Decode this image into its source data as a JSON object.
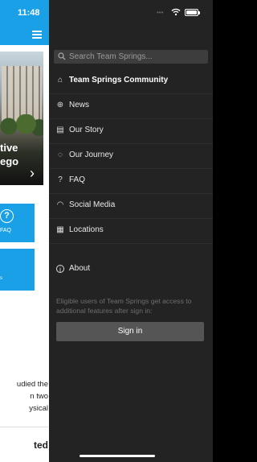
{
  "status_bar": {
    "time": "11:48"
  },
  "app": {
    "hero_caption_lines": [
      "tive",
      "ego"
    ],
    "tiles": [
      {
        "icon": "question-circle-icon",
        "label": "FAQ"
      },
      {
        "label": "s"
      }
    ],
    "body_text_lines": [
      "udied the",
      "n two",
      "ysical"
    ],
    "bottom_text": "ted"
  },
  "drawer": {
    "search": {
      "placeholder": "Search Team Springs..."
    },
    "nav_items": [
      {
        "label": "Team Springs Community",
        "icon": "home-icon",
        "active": true
      },
      {
        "label": "News",
        "icon": "globe-icon"
      },
      {
        "label": "Our Story",
        "icon": "newspaper-icon"
      },
      {
        "label": "Our Journey",
        "icon": "spinner-icon"
      },
      {
        "label": "FAQ",
        "icon": "question-circle-icon"
      },
      {
        "label": "Social Media",
        "icon": "rss-icon"
      },
      {
        "label": "Locations",
        "icon": "grid-icon"
      }
    ],
    "about": {
      "label": "About",
      "icon": "info-circle-icon"
    },
    "note": "Eligible users of Team Springs get access to additional features after sign in:",
    "sign_in_label": "Sign in"
  }
}
